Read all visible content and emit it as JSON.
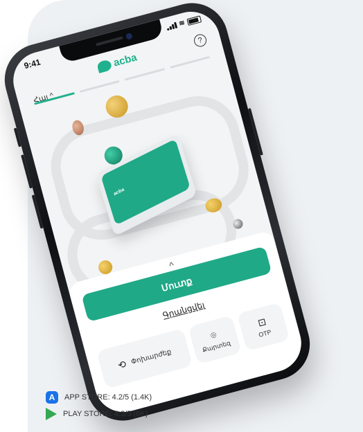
{
  "phone": {
    "status_time": "9:41",
    "brand": "acba",
    "help": "?",
    "language": "Հայ ^",
    "card_label": "acba",
    "sheet": {
      "chevron": "^",
      "login_label": "Մուտք",
      "register_label": "Գրանցվել",
      "actions": [
        {
          "label": "Փոխարժեք",
          "icon": "exchange-icon"
        },
        {
          "label": "Քարտեզ",
          "icon": "map-pin-icon"
        },
        {
          "label": "OTP",
          "icon": "lock-icon"
        }
      ]
    }
  },
  "ratings": {
    "app_store": "APP STORE: 4.2/5 (1.4K)",
    "play_store": "PLAY STORE: 4.3/5 (6K)"
  },
  "colors": {
    "brand": "#1fb18d",
    "button": "#1fa987",
    "panel": "#eef1f4"
  }
}
